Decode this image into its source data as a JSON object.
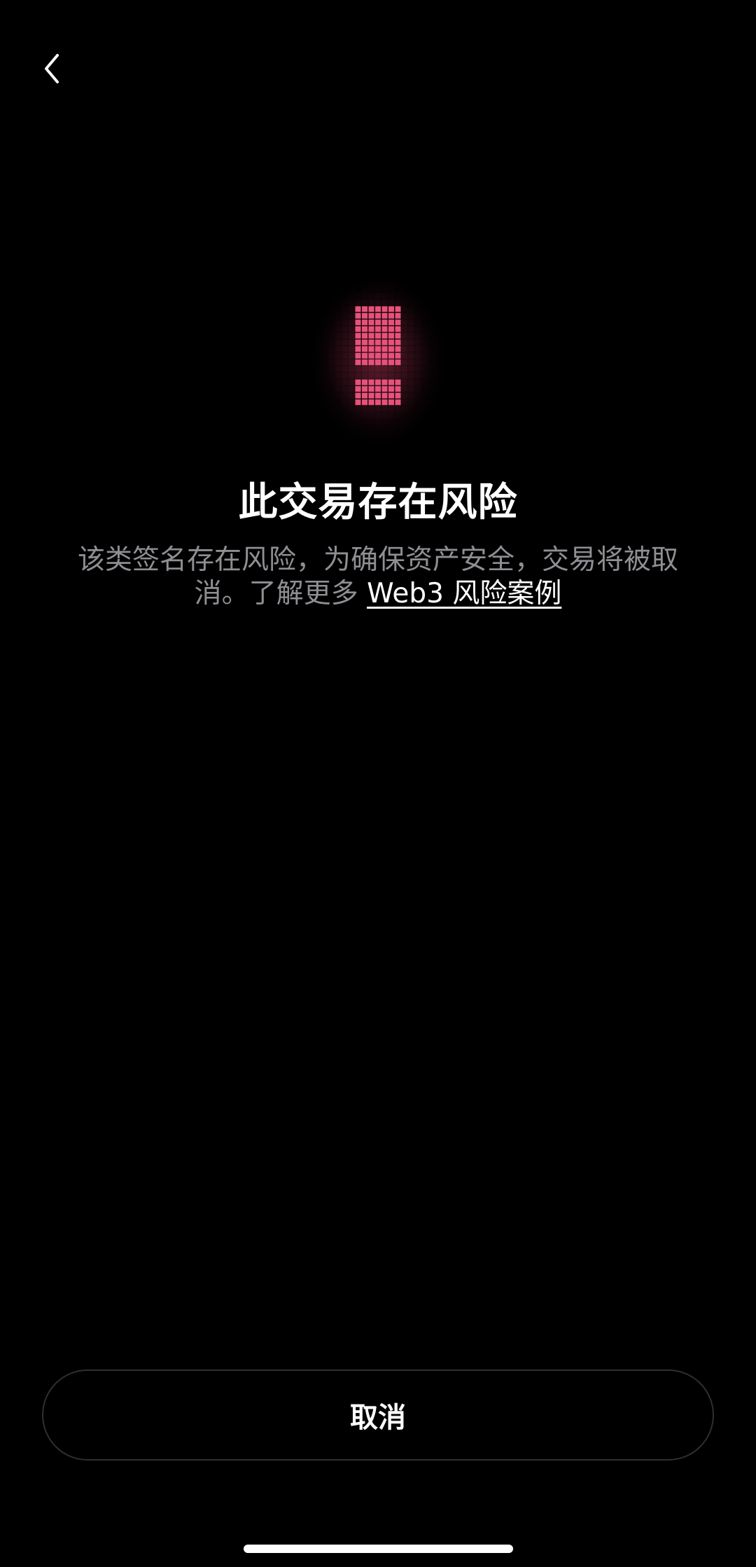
{
  "header": {
    "back_icon": "chevron-left-icon"
  },
  "warning": {
    "icon": "exclamation-pixel-icon",
    "accent_color": "#e8527a"
  },
  "main": {
    "title": "此交易存在风险",
    "description_text": "该类签名存在风险，为确保资产安全，交易将被取消。了解更多 ",
    "link_text": "Web3 风险案例"
  },
  "footer": {
    "cancel_label": "取消"
  }
}
